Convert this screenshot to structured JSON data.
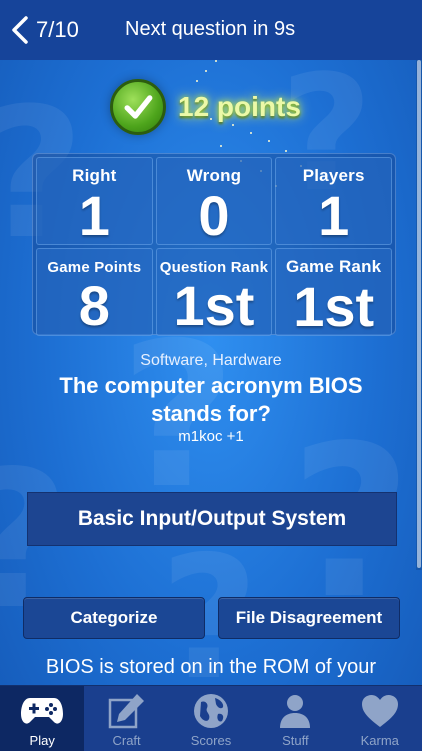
{
  "header": {
    "counter": "7/10",
    "next_question": "Next question in 9s"
  },
  "result": {
    "points_text": "12 points"
  },
  "stats": [
    {
      "label": "Right",
      "value": "1"
    },
    {
      "label": "Wrong",
      "value": "0"
    },
    {
      "label": "Players",
      "value": "1"
    },
    {
      "label": "Game Points",
      "value": "8"
    },
    {
      "label": "Question Rank",
      "value": "1st"
    },
    {
      "label": "Game Rank",
      "value": "1st"
    }
  ],
  "question": {
    "category": "Software, Hardware",
    "text": "The computer acronym BIOS stands for?",
    "author": "m1koc +1",
    "answer": "Basic Input/Output System",
    "explanation": "BIOS is stored on in the ROM of your"
  },
  "actions": {
    "categorize": "Categorize",
    "disagree": "File Disagreement"
  },
  "tabs": [
    {
      "label": "Play",
      "icon": "gamepad-icon",
      "active": true
    },
    {
      "label": "Craft",
      "icon": "pencil-icon",
      "active": false
    },
    {
      "label": "Scores",
      "icon": "globe-icon",
      "active": false
    },
    {
      "label": "Stuff",
      "icon": "person-icon",
      "active": false
    },
    {
      "label": "Karma",
      "icon": "heart-icon",
      "active": false
    }
  ],
  "colors": {
    "background": "#1d6fd3",
    "topbar": "#16449a",
    "button": "#1b4795",
    "tabbar": "#1a3f8e",
    "success": "#4ea51c"
  }
}
